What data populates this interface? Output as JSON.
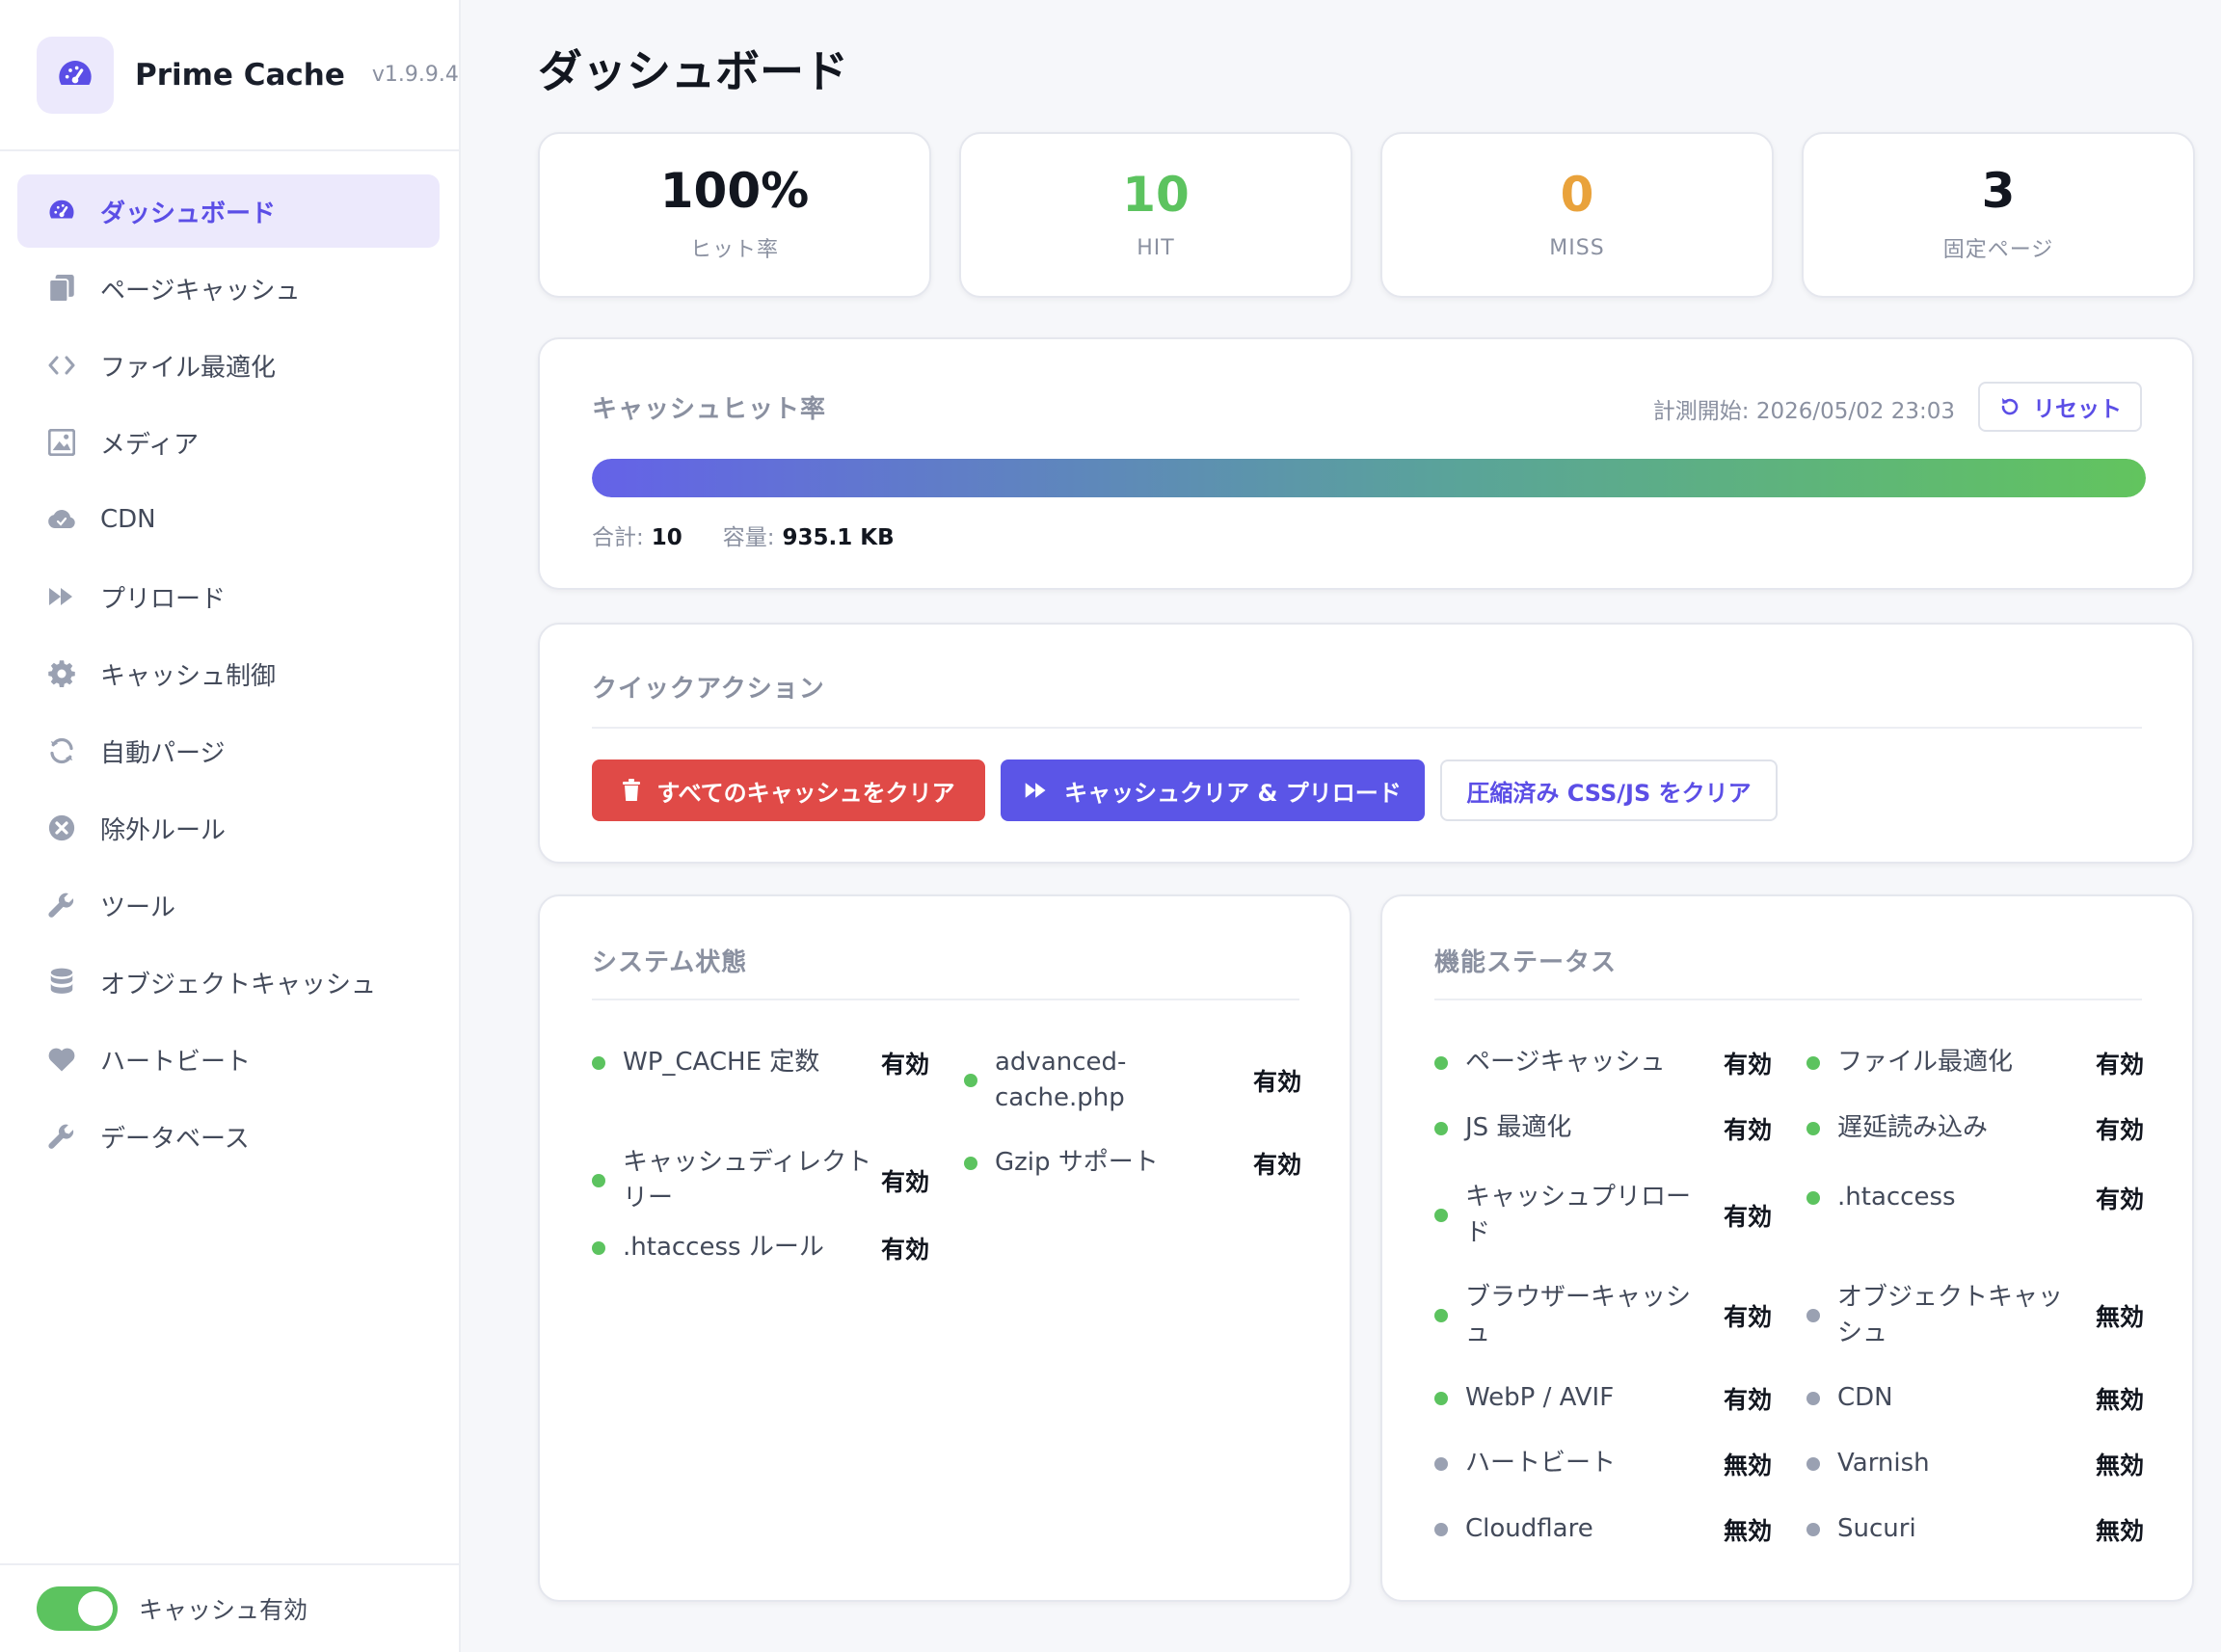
{
  "brand": {
    "name": "Prime Cache",
    "version": "v1.9.9.4"
  },
  "colors": {
    "accent": "#5b4ee6",
    "green": "#5cc35f",
    "red": "#e04a47",
    "orange": "#e9a23b",
    "gray_dot": "#9aa1b2"
  },
  "nav": [
    {
      "label": "ダッシュボード",
      "icon": "dashboard-icon",
      "active": true
    },
    {
      "label": "ページキャッシュ",
      "icon": "pages-icon"
    },
    {
      "label": "ファイル最適化",
      "icon": "code-icon"
    },
    {
      "label": "メディア",
      "icon": "image-icon"
    },
    {
      "label": "CDN",
      "icon": "cloud-icon"
    },
    {
      "label": "プリロード",
      "icon": "fast-forward-icon"
    },
    {
      "label": "キャッシュ制御",
      "icon": "gear-icon"
    },
    {
      "label": "自動パージ",
      "icon": "sync-icon"
    },
    {
      "label": "除外ルール",
      "icon": "exclude-icon"
    },
    {
      "label": "ツール",
      "icon": "wrench-icon"
    },
    {
      "label": "オブジェクトキャッシュ",
      "icon": "database-icon"
    },
    {
      "label": "ハートビート",
      "icon": "heart-icon"
    },
    {
      "label": "データベース",
      "icon": "wrench-icon"
    }
  ],
  "footer": {
    "toggle_label": "キャッシュ有効",
    "toggle_on": true
  },
  "page": {
    "title": "ダッシュボード"
  },
  "stats": [
    {
      "value": "100%",
      "label": "ヒット率",
      "color": "#12161f"
    },
    {
      "value": "10",
      "label": "HIT",
      "color": "#5cc35f"
    },
    {
      "value": "0",
      "label": "MISS",
      "color": "#e9a23b"
    },
    {
      "value": "3",
      "label": "固定ページ",
      "color": "#12161f"
    }
  ],
  "hit_rate": {
    "title": "キャッシュヒット率",
    "measure": "計測開始: 2026/05/02 23:03",
    "reset_label": "リセット",
    "progress_percent": 100,
    "total_label": "合計:",
    "total_value": "10",
    "size_label": "容量:",
    "size_value": "935.1 KB"
  },
  "quick_actions": {
    "title": "クイックアクション",
    "clear_all": "すべてのキャッシュをクリア",
    "clear_preload": "キャッシュクリア & プリロード",
    "clear_minified": "圧縮済み CSS/JS をクリア"
  },
  "system": {
    "title": "システム状態",
    "items": [
      {
        "name": "WP_CACHE 定数",
        "status": "有効",
        "on": true
      },
      {
        "name": "advanced-cache.php",
        "status": "有効",
        "on": true
      },
      {
        "name": "キャッシュディレクトリー",
        "status": "有効",
        "on": true
      },
      {
        "name": "Gzip サポート",
        "status": "有効",
        "on": true
      },
      {
        "name": ".htaccess ルール",
        "status": "有効",
        "on": true
      }
    ]
  },
  "features": {
    "title": "機能ステータス",
    "items": [
      {
        "name": "ページキャッシュ",
        "status": "有効",
        "on": true
      },
      {
        "name": "ファイル最適化",
        "status": "有効",
        "on": true
      },
      {
        "name": "JS 最適化",
        "status": "有効",
        "on": true
      },
      {
        "name": "遅延読み込み",
        "status": "有効",
        "on": true
      },
      {
        "name": "キャッシュプリロード",
        "status": "有効",
        "on": true
      },
      {
        "name": ".htaccess",
        "status": "有効",
        "on": true
      },
      {
        "name": "ブラウザーキャッシュ",
        "status": "有効",
        "on": true
      },
      {
        "name": "オブジェクトキャッシュ",
        "status": "無効",
        "on": false
      },
      {
        "name": "WebP / AVIF",
        "status": "有効",
        "on": true
      },
      {
        "name": "CDN",
        "status": "無効",
        "on": false
      },
      {
        "name": "ハートビート",
        "status": "無効",
        "on": false
      },
      {
        "name": "Varnish",
        "status": "無効",
        "on": false
      },
      {
        "name": "Cloudflare",
        "status": "無効",
        "on": false
      },
      {
        "name": "Sucuri",
        "status": "無効",
        "on": false
      }
    ]
  }
}
